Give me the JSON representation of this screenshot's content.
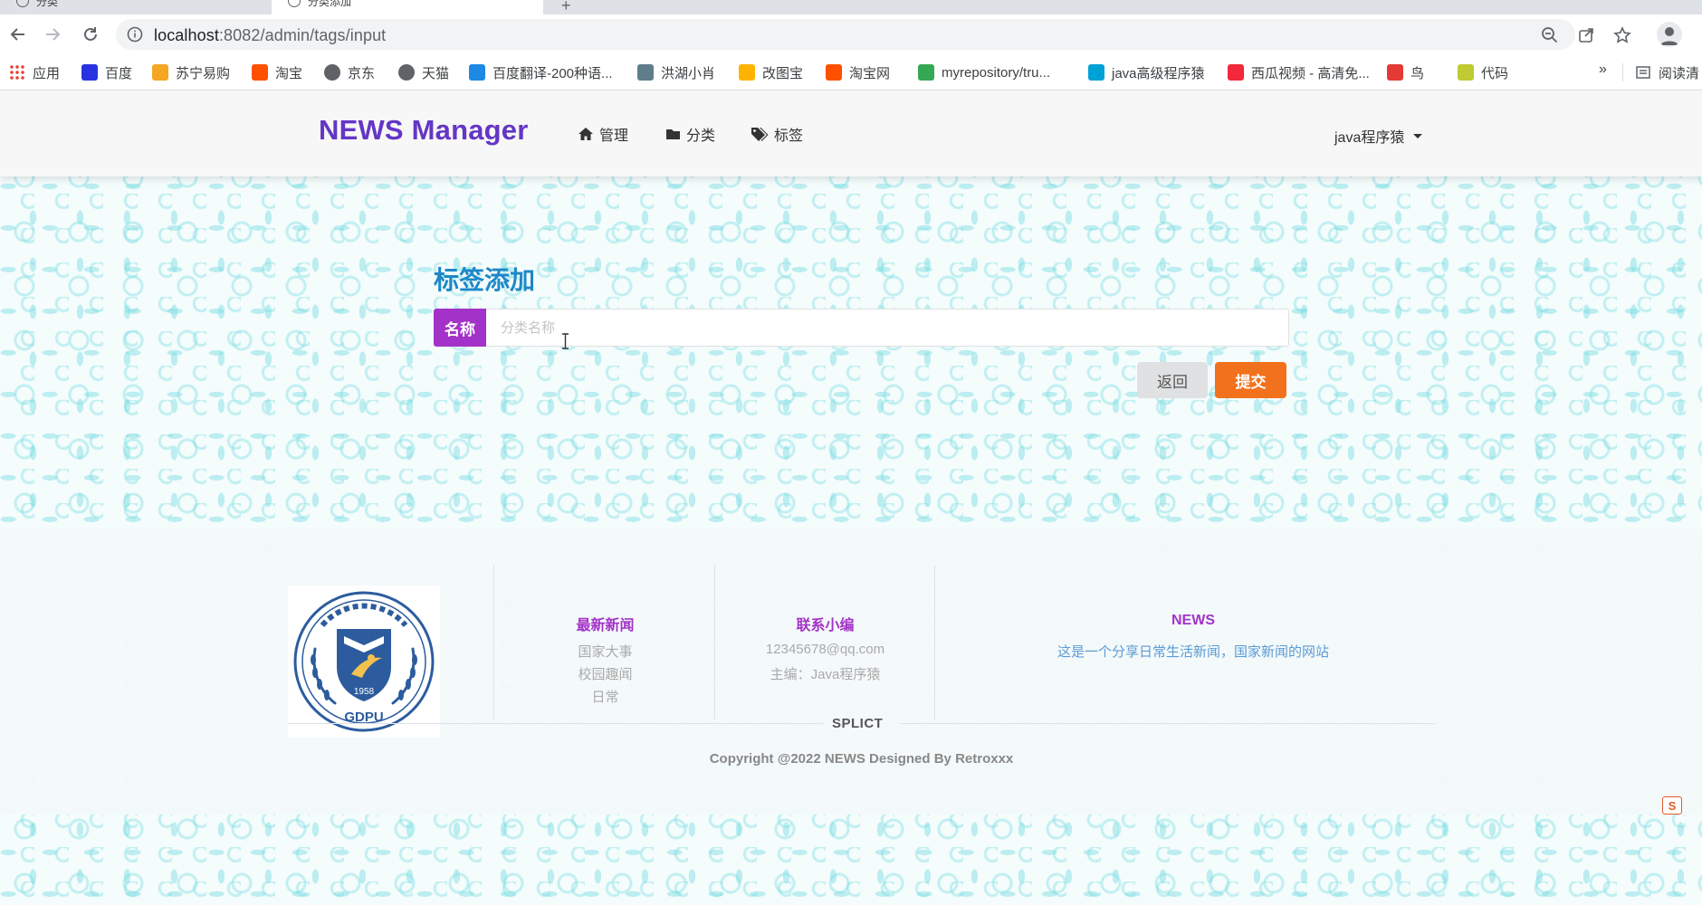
{
  "browser": {
    "tabs": [
      {
        "label": "分类"
      },
      {
        "label": "分类添加"
      }
    ],
    "url_host": "localhost",
    "url_port_path": ":8082/admin/tags/input",
    "bookmarks": [
      {
        "label": "应用",
        "icon": "apps-grid-icon"
      },
      {
        "label": "百度",
        "icon": "baidu-icon",
        "color": "#2932e1"
      },
      {
        "label": "苏宁易购",
        "icon": "suning-icon",
        "color": "#f5a623"
      },
      {
        "label": "淘宝",
        "icon": "taobao-icon",
        "color": "#ff5000"
      },
      {
        "label": "京东",
        "icon": "globe-icon",
        "color": "#5f6368"
      },
      {
        "label": "天猫",
        "icon": "globe-icon",
        "color": "#5f6368"
      },
      {
        "label": "百度翻译-200种语...",
        "icon": "translate-icon",
        "color": "#1e88e5"
      },
      {
        "label": "洪湖小肖",
        "icon": "feather-icon",
        "color": "#607d8b"
      },
      {
        "label": "改图宝",
        "icon": "gaitubao-icon",
        "color": "#ffb300"
      },
      {
        "label": "淘宝网",
        "icon": "taobao-icon",
        "color": "#ff5000"
      },
      {
        "label": "myrepository/tru...",
        "icon": "chrome-icon",
        "color": "#34a853"
      },
      {
        "label": "java高级程序猿",
        "icon": "bilibili-icon",
        "color": "#00a1d6"
      },
      {
        "label": "西瓜视频 - 高清免...",
        "icon": "xigua-icon",
        "color": "#f2283c"
      },
      {
        "label": "鸟",
        "icon": "bird-icon",
        "color": "#e53935"
      },
      {
        "label": "代码",
        "icon": "leaf-icon",
        "color": "#c0ca33"
      }
    ],
    "reading_list": "阅读清"
  },
  "nav": {
    "brand": "NEWS Manager",
    "items": [
      {
        "label": "管理",
        "icon": "home-icon"
      },
      {
        "label": "分类",
        "icon": "folder-icon"
      },
      {
        "label": "标签",
        "icon": "tags-icon"
      }
    ],
    "user": "java程序猿"
  },
  "form": {
    "title": "标签添加",
    "name_label": "名称",
    "name_placeholder": "分类名称",
    "name_value": "",
    "back_label": "返回",
    "submit_label": "提交"
  },
  "footer": {
    "logo_year": "1958",
    "logo_text": "GDPU",
    "col1": {
      "title": "最新新闻",
      "items": [
        "国家大事",
        "校园趣闻",
        "日常"
      ]
    },
    "col2": {
      "title": "联系小编",
      "items": [
        "12345678@qq.com",
        "主编：Java程序猿"
      ]
    },
    "col3": {
      "title": "NEWS",
      "desc": "这是一个分享日常生活新闻，国家新闻的网站"
    },
    "splict": "SPLICT",
    "copyright": "Copyright @2022 NEWS Designed By Retroxxx"
  },
  "colors": {
    "brand": "#6436c5",
    "label_purple": "#a333c8",
    "title_blue": "#1e88c7",
    "submit_orange": "#f2711c"
  }
}
